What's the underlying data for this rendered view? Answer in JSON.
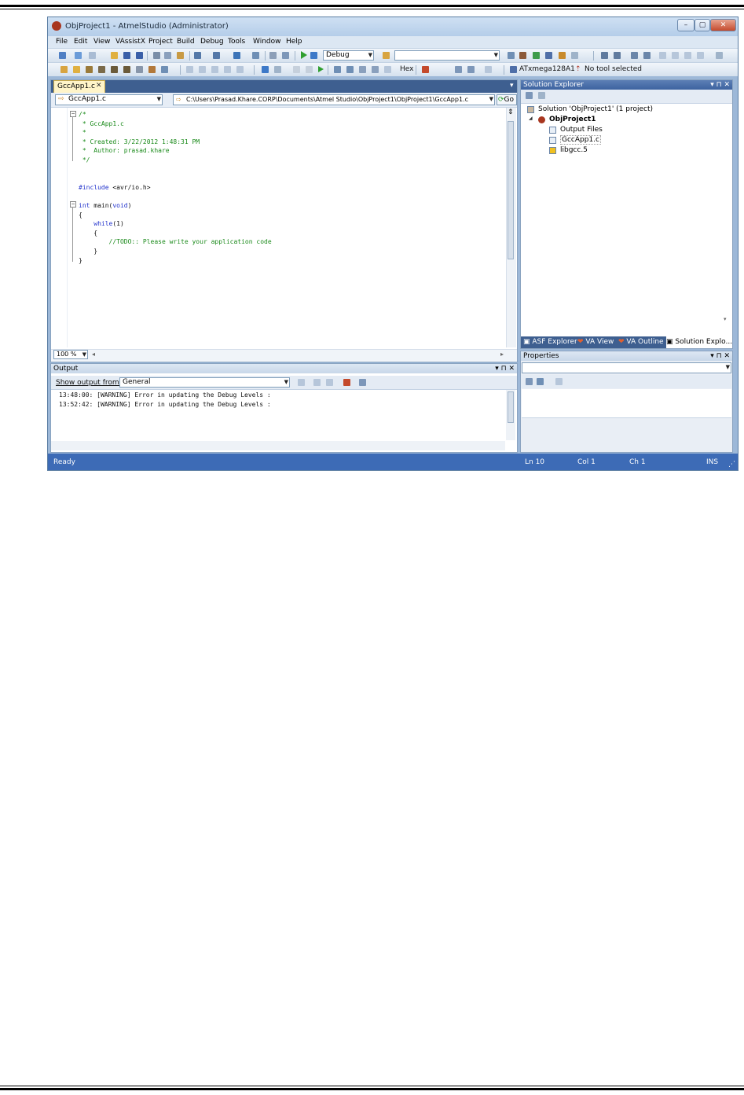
{
  "window": {
    "title": "ObjProject1 - AtmelStudio (Administrator)",
    "caption_buttons": {
      "minimize": "–",
      "maximize": "▢",
      "close": "✕"
    }
  },
  "menu": [
    "File",
    "Edit",
    "View",
    "VAssistX",
    "Project",
    "Build",
    "Debug",
    "Tools",
    "Window",
    "Help"
  ],
  "toolbar": {
    "configuration": "Debug",
    "search_value": "",
    "hex_label": "Hex",
    "device": "ATxmega128A1",
    "tool": "No tool selected"
  },
  "editor": {
    "tab_label": "GccApp1.c",
    "tab_close": "✕",
    "tab_dropdown": "▾",
    "file_combo": "GccApp1.c",
    "path_combo": "C:\\Users\\Prasad.Khare.CORP\\Documents\\Atmel Studio\\ObjProject1\\ObjProject1\\GccApp1.c",
    "go_label": "Go",
    "zoom": "100 %",
    "code_lines": [
      {
        "text": "/*",
        "style": "green"
      },
      {
        "text": " * GccApp1.c",
        "style": "green"
      },
      {
        "text": " *",
        "style": "green"
      },
      {
        "text": " * Created: 3/22/2012 1:48:31 PM",
        "style": "green"
      },
      {
        "text": " *  Author: prasad.khare",
        "style": "green"
      },
      {
        "text": " */",
        "style": "green"
      },
      {
        "text": "",
        "style": "black"
      },
      {
        "text": "",
        "style": "black"
      },
      {
        "text": "#include <avr/io.h>",
        "style": "mixed_include"
      },
      {
        "text": "",
        "style": "black"
      },
      {
        "text": "int main(void)",
        "style": "mixed_int"
      },
      {
        "text": "{",
        "style": "black"
      },
      {
        "text": "    while(1)",
        "style": "mixed_while"
      },
      {
        "text": "    {",
        "style": "black"
      },
      {
        "text": "        //TODO:: Please write your application code",
        "style": "green"
      },
      {
        "text": "    }",
        "style": "black"
      },
      {
        "text": "}",
        "style": "black"
      }
    ]
  },
  "solution_explorer": {
    "title": "Solution Explorer",
    "pin_controls": "▾ ⊓ ✕",
    "items": [
      {
        "label": "Solution 'ObjProject1' (1 project)",
        "indent": 0,
        "icon": "solution-icon"
      },
      {
        "label": "ObjProject1",
        "indent": 1,
        "icon": "project-icon",
        "bold": true
      },
      {
        "label": "Output Files",
        "indent": 2,
        "icon": "folder-icon"
      },
      {
        "label": "GccApp1.c",
        "indent": 2,
        "icon": "c-file-icon"
      },
      {
        "label": "libgcc.5",
        "indent": 2,
        "icon": "warning-icon"
      }
    ],
    "tabs": [
      "ASF Explorer",
      "VA View",
      "VA Outline",
      "Solution Explo..."
    ]
  },
  "properties": {
    "title": "Properties",
    "pin_controls": "▾ ⊓ ✕"
  },
  "output": {
    "title": "Output",
    "pin_controls": "▾ ⊓ ✕",
    "show_label": "Show output from:",
    "source": "General",
    "lines": [
      "13:48:00: [WARNING] Error in updating the Debug Levels :",
      "13:52:42: [WARNING] Error in updating the Debug Levels :"
    ]
  },
  "status": {
    "state": "Ready",
    "line": "Ln 10",
    "col": "Col 1",
    "ch": "Ch 1",
    "mode": "INS"
  }
}
